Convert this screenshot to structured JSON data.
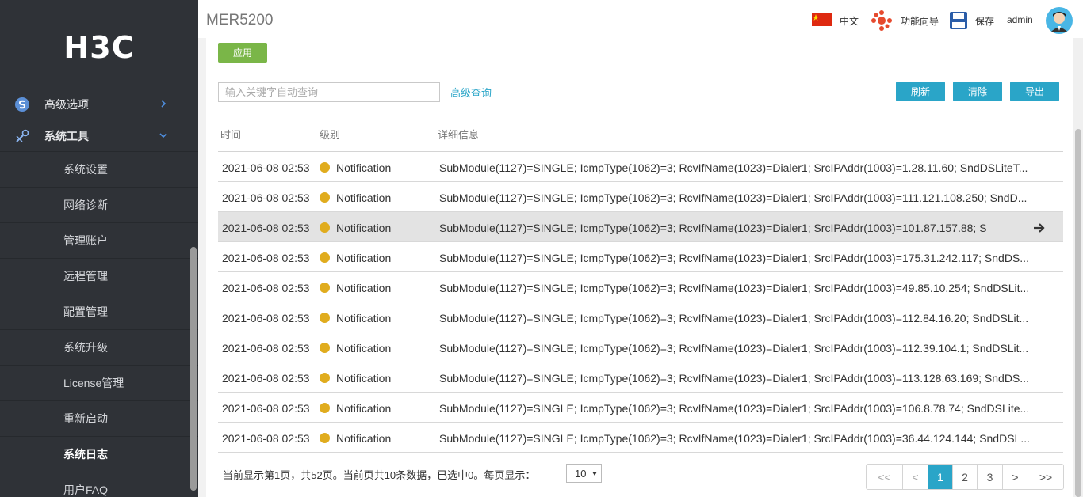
{
  "app": {
    "logo_text": "H3C",
    "device_name": "MER5200"
  },
  "header": {
    "language": "中文",
    "wizard": "功能向导",
    "save": "保存",
    "user": "admin"
  },
  "sidebar": {
    "sections": [
      {
        "label": "高级选项",
        "expanded": false
      },
      {
        "label": "系统工具",
        "expanded": true
      }
    ],
    "sub_items": [
      {
        "label": "系统设置"
      },
      {
        "label": "网络诊断"
      },
      {
        "label": "管理账户"
      },
      {
        "label": "远程管理"
      },
      {
        "label": "配置管理"
      },
      {
        "label": "系统升级"
      },
      {
        "label": "License管理"
      },
      {
        "label": "重新启动"
      },
      {
        "label": "系统日志",
        "active": true
      },
      {
        "label": "用户FAQ"
      }
    ]
  },
  "toolbar": {
    "apply": "应用",
    "search_placeholder": "输入关键字自动查询",
    "advanced_search": "高级查询",
    "refresh": "刷新",
    "clear": "清除",
    "export": "导出"
  },
  "table": {
    "columns": [
      "时间",
      "级别",
      "详细信息"
    ],
    "rows": [
      {
        "time": "2021-06-08 02:53",
        "level": "Notification",
        "detail": "SubModule(1127)=SINGLE; IcmpType(1062)=3; RcvIfName(1023)=Dialer1; SrcIPAddr(1003)=1.28.11.60; SndDSLiteT..."
      },
      {
        "time": "2021-06-08 02:53",
        "level": "Notification",
        "detail": "SubModule(1127)=SINGLE; IcmpType(1062)=3; RcvIfName(1023)=Dialer1; SrcIPAddr(1003)=111.121.108.250; SndD..."
      },
      {
        "time": "2021-06-08 02:53",
        "level": "Notification",
        "detail": "SubModule(1127)=SINGLE; IcmpType(1062)=3; RcvIfName(1023)=Dialer1; SrcIPAddr(1003)=101.87.157.88; S",
        "highlighted": true
      },
      {
        "time": "2021-06-08 02:53",
        "level": "Notification",
        "detail": "SubModule(1127)=SINGLE; IcmpType(1062)=3; RcvIfName(1023)=Dialer1; SrcIPAddr(1003)=175.31.242.117; SndDS..."
      },
      {
        "time": "2021-06-08 02:53",
        "level": "Notification",
        "detail": "SubModule(1127)=SINGLE; IcmpType(1062)=3; RcvIfName(1023)=Dialer1; SrcIPAddr(1003)=49.85.10.254; SndDSLit..."
      },
      {
        "time": "2021-06-08 02:53",
        "level": "Notification",
        "detail": "SubModule(1127)=SINGLE; IcmpType(1062)=3; RcvIfName(1023)=Dialer1; SrcIPAddr(1003)=112.84.16.20; SndDSLit..."
      },
      {
        "time": "2021-06-08 02:53",
        "level": "Notification",
        "detail": "SubModule(1127)=SINGLE; IcmpType(1062)=3; RcvIfName(1023)=Dialer1; SrcIPAddr(1003)=112.39.104.1; SndDSLit..."
      },
      {
        "time": "2021-06-08 02:53",
        "level": "Notification",
        "detail": "SubModule(1127)=SINGLE; IcmpType(1062)=3; RcvIfName(1023)=Dialer1; SrcIPAddr(1003)=113.128.63.169; SndDS..."
      },
      {
        "time": "2021-06-08 02:53",
        "level": "Notification",
        "detail": "SubModule(1127)=SINGLE; IcmpType(1062)=3; RcvIfName(1023)=Dialer1; SrcIPAddr(1003)=106.8.78.74; SndDSLite..."
      },
      {
        "time": "2021-06-08 02:53",
        "level": "Notification",
        "detail": "SubModule(1127)=SINGLE; IcmpType(1062)=3; RcvIfName(1023)=Dialer1; SrcIPAddr(1003)=36.44.124.144; SndDSL..."
      }
    ]
  },
  "footer": {
    "status": "当前显示第1页，共52页。当前页共10条数据，已选中0。每页显示：",
    "page_size": "10",
    "pages": [
      "<<",
      "<",
      "1",
      "2",
      "3",
      ">",
      ">>"
    ],
    "current_page": "1"
  },
  "colors": {
    "sidebar_bg": "#2f3237",
    "accent": "#2aa5c8",
    "apply_green": "#7ab648",
    "notification_dot": "#e0ac1e",
    "highlight_row": "#e3e3e3"
  }
}
